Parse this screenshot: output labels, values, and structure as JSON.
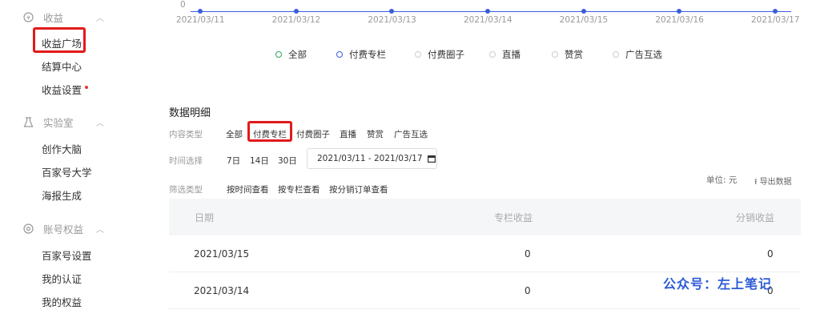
{
  "sidebar": {
    "groups": [
      {
        "label": "收益",
        "icon": "yen-circle-icon",
        "items": [
          {
            "label": "收益广场",
            "highlighted": true
          },
          {
            "label": "结算中心"
          },
          {
            "label": "收益设置",
            "badge_dot": true
          }
        ]
      },
      {
        "label": "实验室",
        "icon": "flask-icon",
        "items": [
          {
            "label": "创作大脑"
          },
          {
            "label": "百家号大学"
          },
          {
            "label": "海报生成"
          }
        ]
      },
      {
        "label": "账号权益",
        "icon": "gear-icon",
        "items": [
          {
            "label": "百家号设置"
          },
          {
            "label": "我的认证"
          },
          {
            "label": "我的权益"
          }
        ]
      }
    ]
  },
  "chart_data": {
    "type": "line",
    "x": [
      "2021/03/11",
      "2021/03/12",
      "2021/03/13",
      "2021/03/14",
      "2021/03/15",
      "2021/03/16",
      "2021/03/17"
    ],
    "series": [
      {
        "name": "付费专栏",
        "values": [
          0,
          0,
          0,
          0,
          0,
          0,
          0
        ],
        "color": "#3c5ce0"
      }
    ],
    "y_tick": "0",
    "legend": [
      "全部",
      "付费专栏",
      "付费圈子",
      "直播",
      "赞赏",
      "广告互选"
    ]
  },
  "detail": {
    "title": "数据明细",
    "content_type_label": "内容类型",
    "content_types": [
      "全部",
      "付费专栏",
      "付费圈子",
      "直播",
      "赞赏",
      "广告互选"
    ],
    "time_label": "时间选择",
    "time_options": [
      "7日",
      "14日",
      "30日"
    ],
    "date_range": "2021/03/11 - 2021/03/17",
    "filter_label": "筛选类型",
    "filter_options": [
      "按时间查看",
      "按专栏查看",
      "按分销订单查看"
    ],
    "unit": "单位: 元",
    "export": "导出数据"
  },
  "table": {
    "headers": [
      "日期",
      "专栏收益",
      "分销收益"
    ],
    "rows": [
      [
        "2021/03/15",
        "0",
        "0"
      ],
      [
        "2021/03/14",
        "0",
        "0"
      ]
    ]
  },
  "watermark": "公众号：左上笔记",
  "colors": {
    "accent": "#3c5ce0",
    "highlight": "#e21a1a",
    "legend_active": "#2aa85a"
  }
}
